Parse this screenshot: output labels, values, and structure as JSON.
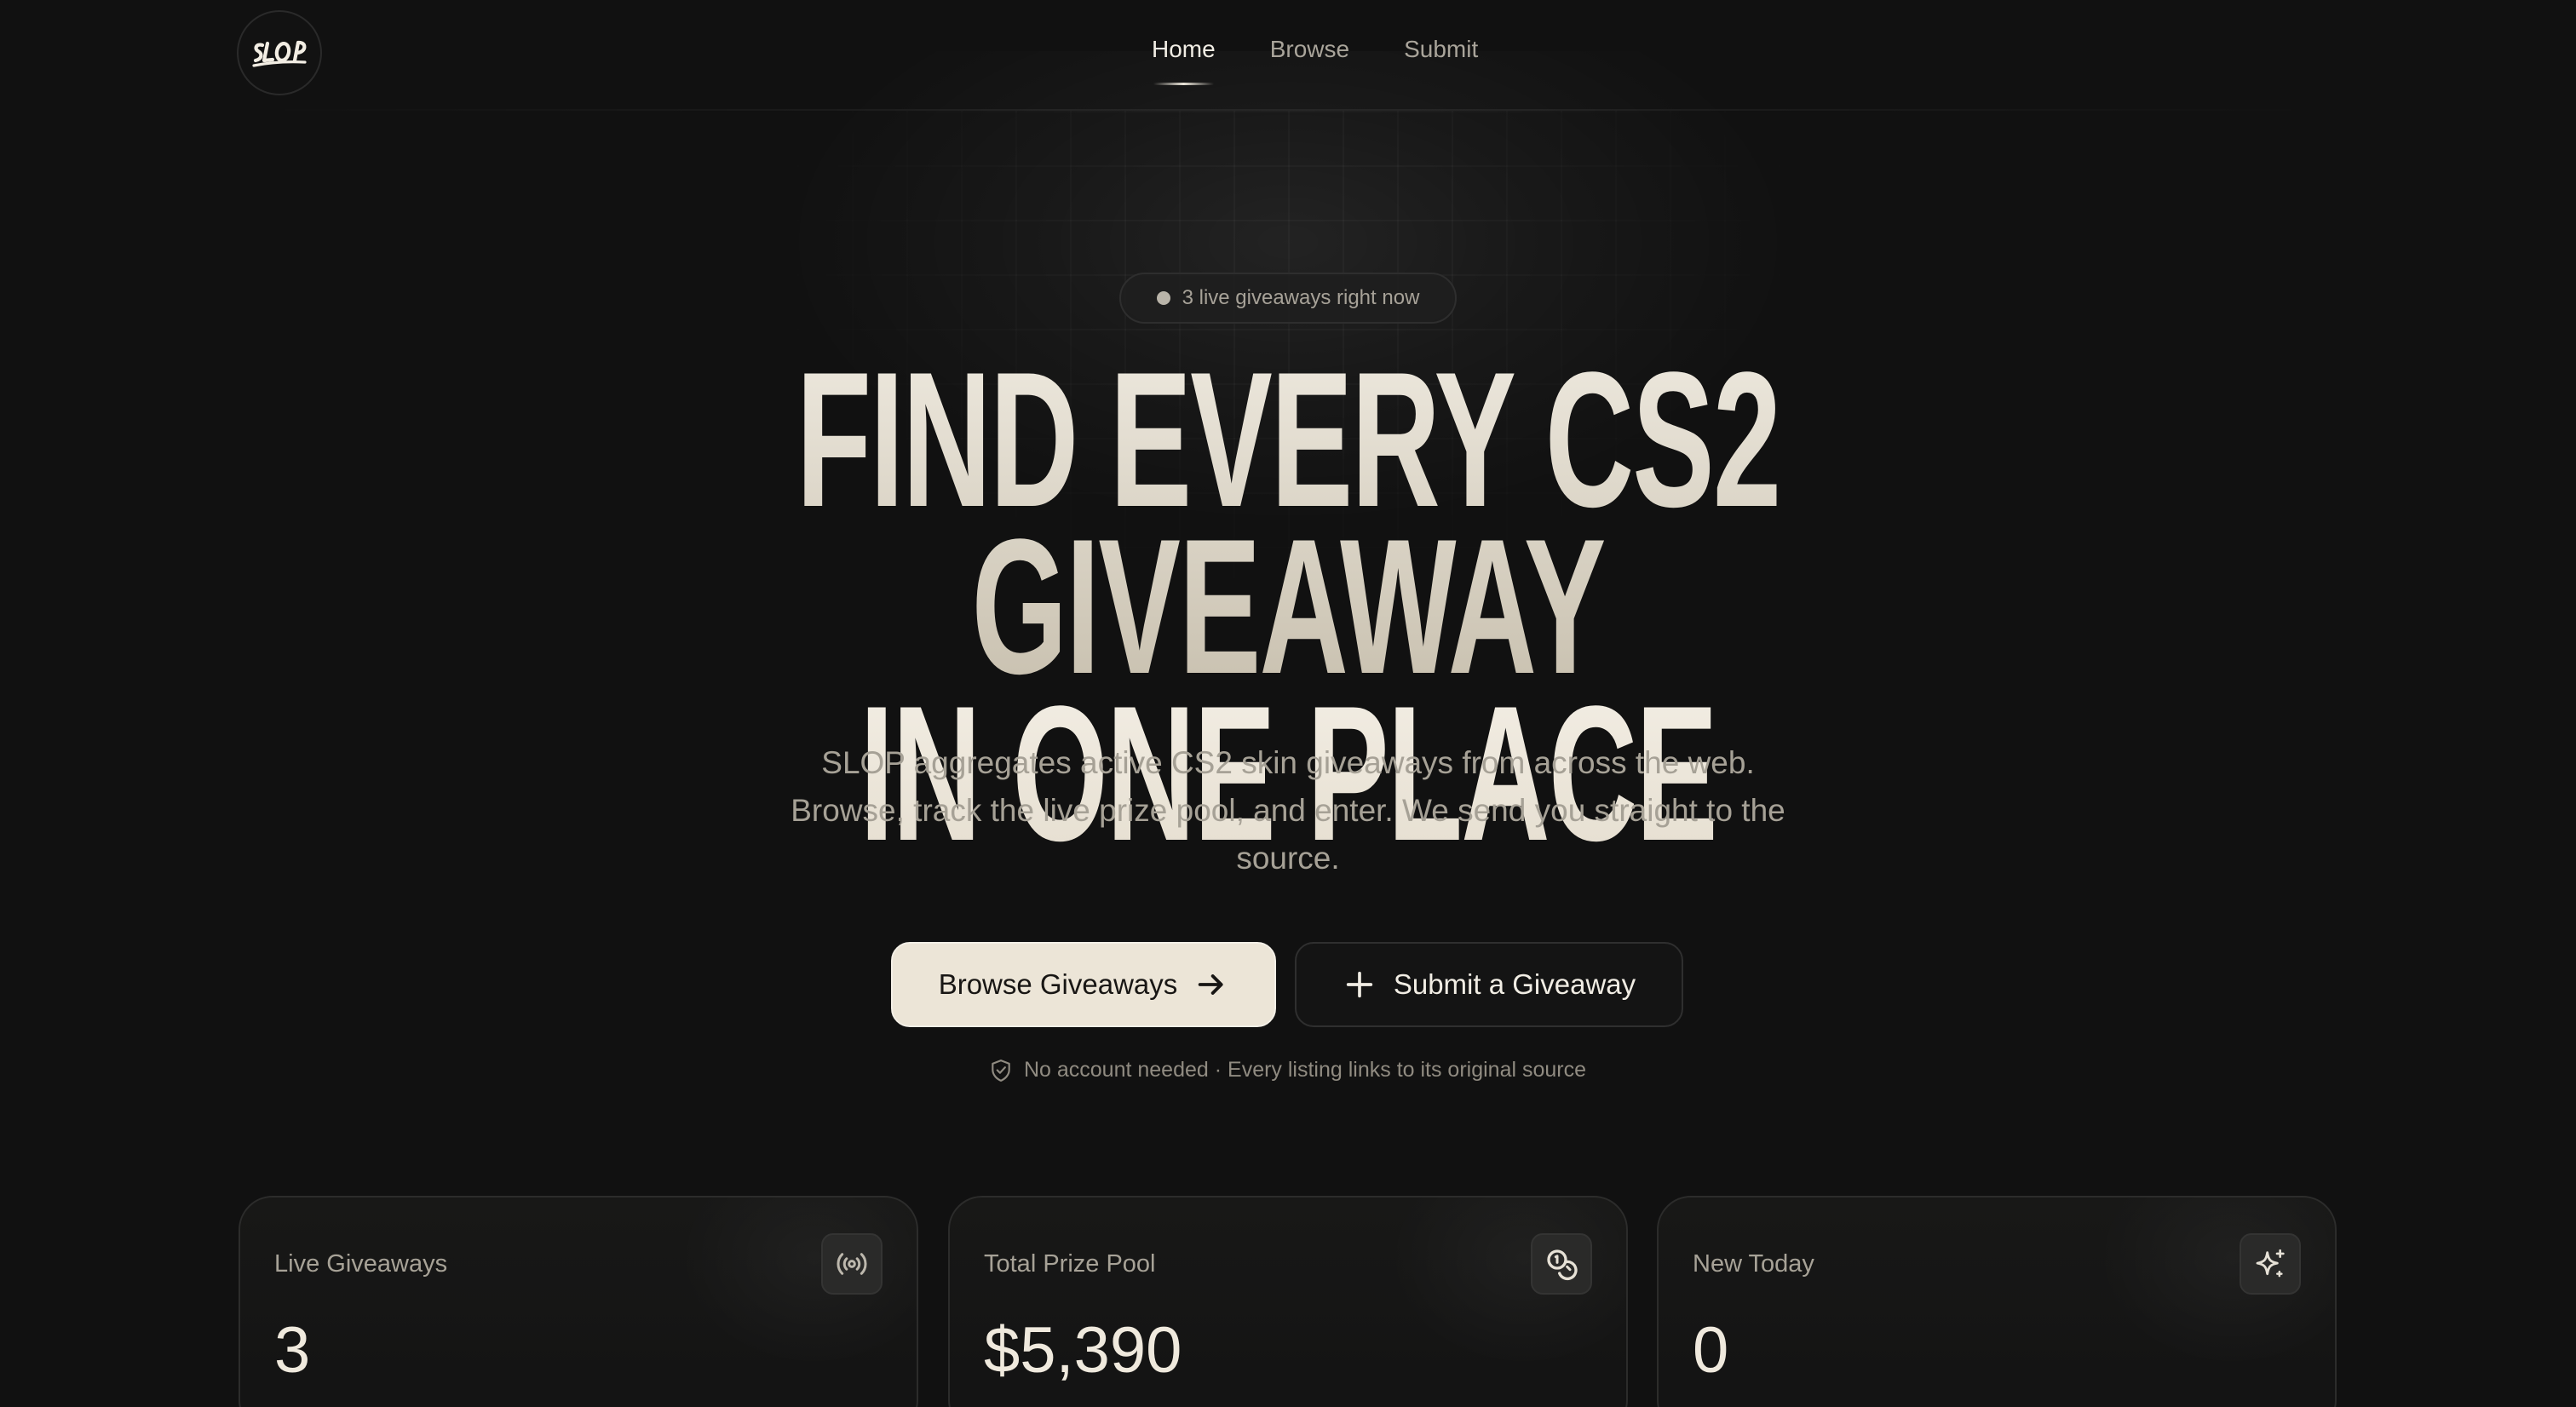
{
  "nav": {
    "logo_text": "SLOP",
    "links": [
      {
        "label": "Home",
        "active": true
      },
      {
        "label": "Browse",
        "active": false
      },
      {
        "label": "Submit",
        "active": false
      }
    ]
  },
  "hero": {
    "badge": "3 live giveaways right now",
    "headline_line1": "FIND EVERY CS2 GIVEAWAY",
    "headline_line2": "IN ONE PLACE",
    "subtitle": "SLOP aggregates active CS2 skin giveaways from across the web. Browse, track the live prize pool, and enter. We send you straight to the source.",
    "primary_cta": {
      "label": "Browse Giveaways",
      "icon": "arrow-right-icon"
    },
    "secondary_cta": {
      "label": "Submit a Giveaway",
      "icon": "plus-icon"
    },
    "note": "No account needed · Every listing links to its original source",
    "note_icon": "shield-check-icon"
  },
  "stats": [
    {
      "label": "Live Giveaways",
      "value": "3",
      "icon": "broadcast-icon"
    },
    {
      "label": "Total Prize Pool",
      "value": "$5,390",
      "icon": "coins-icon"
    },
    {
      "label": "New Today",
      "value": "0",
      "icon": "sparkles-icon"
    }
  ],
  "colors": {
    "background": "#111111",
    "accent": "#ece5d7",
    "text_primary": "#efe9dd",
    "text_muted": "#a7a297",
    "border": "#2c2c2b"
  }
}
